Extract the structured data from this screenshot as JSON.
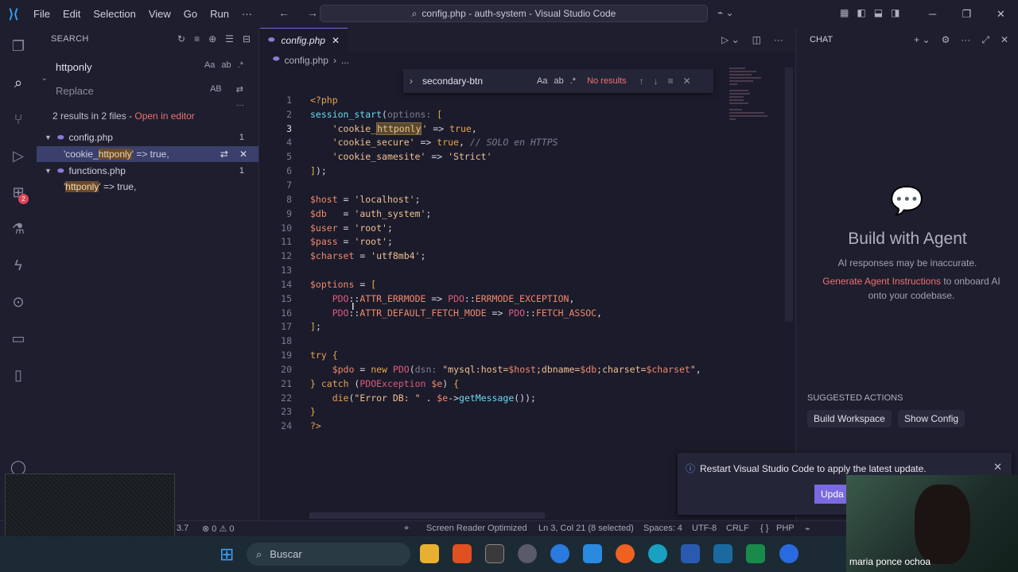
{
  "titlebar": {
    "menu": [
      "File",
      "Edit",
      "Selection",
      "View",
      "Go",
      "Run",
      "···"
    ],
    "command_center": "config.php - auth-system - Visual Studio Code"
  },
  "search_view": {
    "header": "SEARCH",
    "query": "httponly",
    "query_opts": [
      "Aa",
      "ab",
      ".*"
    ],
    "replace_placeholder": "Replace",
    "replace_opt": "AB",
    "summary": "2 results in 2 files - ",
    "open_in_editor": "Open in editor",
    "files": [
      {
        "name": "config.php",
        "count": "1",
        "match_pre": "'cookie_",
        "match_hl": "httponly",
        "match_post": "' => true,"
      },
      {
        "name": "functions.php",
        "count": "1",
        "match_pre": "'",
        "match_hl": "httponly",
        "match_post": "' => true,"
      }
    ]
  },
  "editor": {
    "tab": "config.php",
    "breadcrumb": "config.php",
    "breadcrumb_more": "...",
    "find": {
      "query": "secondary-btn",
      "opts": [
        "Aa",
        "ab",
        ".*"
      ],
      "result": "No results"
    }
  },
  "chat": {
    "header": "CHAT",
    "title": "Build with Agent",
    "note": "AI responses may be inaccurate.",
    "gen_link": "Generate Agent Instructions",
    "gen_rest": " to onboard AI onto your codebase.",
    "suggested": "SUGGESTED ACTIONS",
    "actions": [
      "Build Workspace",
      "Show Config"
    ]
  },
  "notification": {
    "message": "Restart Visual Studio Code to apply the latest update.",
    "button": "Upda"
  },
  "status": {
    "left_version": "3.7",
    "problems": "⊗ 0 ⚠ 0",
    "screen_reader": "Screen Reader Optimized",
    "position": "Ln 3, Col 21 (8 selected)",
    "spaces": "Spaces: 4",
    "encoding": "UTF-8",
    "eol": "CRLF",
    "language": "PHP"
  },
  "taskbar": {
    "search": "Buscar"
  },
  "webcam": {
    "name": "maria ponce ochoa"
  },
  "colors": {
    "accent": "#7a6ae0",
    "link": "#f07070",
    "match_highlight": "#6a4a2a"
  }
}
